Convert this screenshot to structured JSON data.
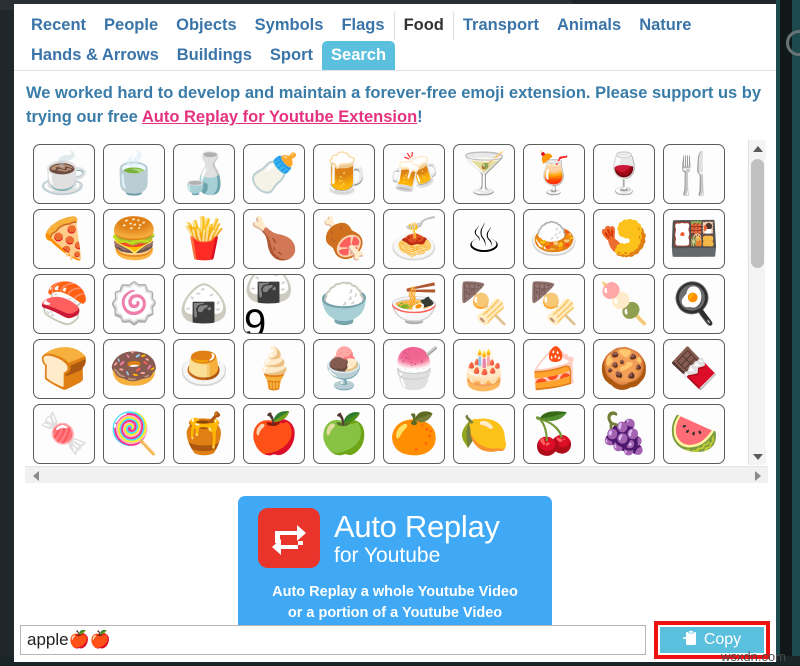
{
  "tabs_row1": [
    {
      "label": "Recent",
      "state": "normal"
    },
    {
      "label": "People",
      "state": "normal"
    },
    {
      "label": "Objects",
      "state": "normal"
    },
    {
      "label": "Symbols",
      "state": "normal"
    },
    {
      "label": "Flags",
      "state": "normal"
    },
    {
      "label": "Food",
      "state": "active-outline"
    },
    {
      "label": "Transport",
      "state": "normal"
    },
    {
      "label": "Animals",
      "state": "normal"
    },
    {
      "label": "Nature",
      "state": "normal"
    }
  ],
  "tabs_row2": [
    {
      "label": "Hands & Arrows",
      "state": "normal"
    },
    {
      "label": "Buildings",
      "state": "normal"
    },
    {
      "label": "Sport",
      "state": "normal"
    },
    {
      "label": "Search",
      "state": "active-fill"
    }
  ],
  "promo": {
    "text_before": "We worked hard to develop and maintain a forever-free emoji extension. Please support us by trying our free ",
    "link_text": "Auto Replay for Youtube Extension",
    "text_after": "!"
  },
  "emoji_grid": {
    "columns": 10,
    "rows": [
      [
        "☕",
        "🍵",
        "🍶",
        "🍼",
        "🍺",
        "🍻",
        "🍸",
        "🍹",
        "🍷",
        "🍴"
      ],
      [
        "🍕",
        "🍔",
        "🍟",
        "🍗",
        "🍖",
        "🍝",
        "♨",
        "🍛",
        "🍤",
        "🍱"
      ],
      [
        "🍣",
        "🍥",
        "🍙",
        "🍙9",
        "🍚",
        "🍜",
        "🍢",
        "🍢",
        "🍡",
        "🍳"
      ],
      [
        "🍞",
        "🍩",
        "🍮",
        "🍦",
        "🍨",
        "🍧",
        "🎂",
        "🍰",
        "🍪",
        "🍫"
      ],
      [
        "🍬",
        "🍭",
        "🍯",
        "🍎",
        "🍏",
        "🍊",
        "🍋",
        "🍒",
        "🍇",
        "🍉"
      ]
    ],
    "row_names": [
      [
        "coffee",
        "tea",
        "sake",
        "baby-bottle",
        "beer",
        "beers",
        "cocktail",
        "tropical-drink",
        "wine-glass",
        "fork-and-knife"
      ],
      [
        "pizza",
        "hamburger",
        "french-fries",
        "poultry-leg",
        "meat-on-bone",
        "spaghetti",
        "hot-springs",
        "curry-rice",
        "fried-shrimp",
        "bento-box"
      ],
      [
        "sushi",
        "fish-cake",
        "rice-ball",
        "rice-cracker",
        "cooked-rice",
        "ramen",
        "pot-of-food",
        "oden",
        "dango",
        "fried-egg"
      ],
      [
        "bread",
        "doughnut",
        "custard",
        "soft-ice-cream",
        "ice-cream",
        "shaved-ice",
        "birthday-cake",
        "shortcake",
        "cookie",
        "chocolate-bar"
      ],
      [
        "candy",
        "lollipop",
        "honey-pot",
        "red-apple",
        "green-apple",
        "tangerine",
        "lemon",
        "cherries",
        "grapes",
        "watermelon"
      ]
    ]
  },
  "scrollbars": {
    "vertical_thumb_percent": 38,
    "up_arrow": "▲",
    "down_arrow": "▼",
    "left_arrow": "◀",
    "right_arrow": "▶"
  },
  "banner": {
    "title": "Auto Replay",
    "subtitle": "for Youtube",
    "description_line1": "Auto Replay a whole Youtube Video",
    "description_line2": "or a portion of a Youtube Video",
    "logo_icon": "repeat-icon",
    "background_color": "#3fa9f5",
    "logo_color": "#e8342a"
  },
  "bottom": {
    "input_value": "apple🍎🍎",
    "input_placeholder": "",
    "copy_label": "Copy",
    "copy_icon": "clipboard-icon",
    "copy_button_color": "#5bc0de",
    "highlight_color": "#ee1111"
  },
  "watermark": {
    "text": "wsxdn.com"
  }
}
